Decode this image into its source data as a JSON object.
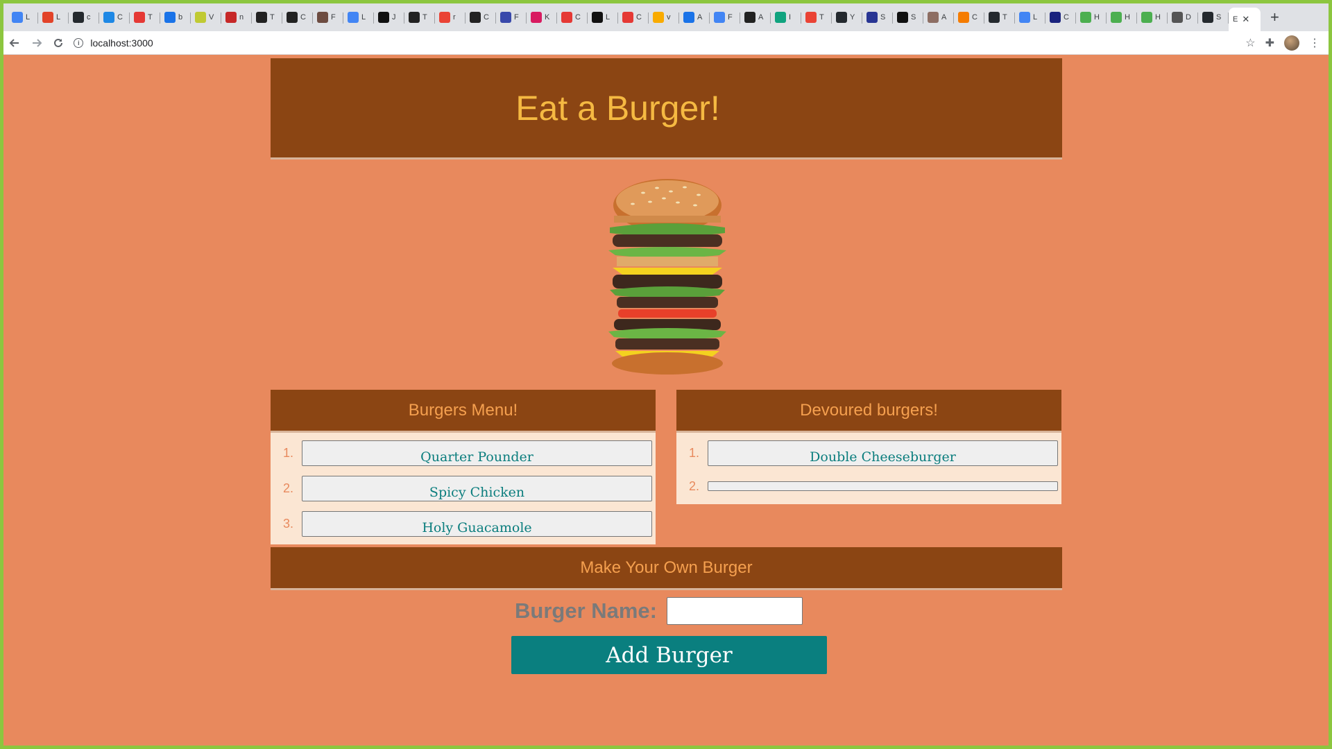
{
  "browser": {
    "tabs": [
      {
        "icon": "google-docs-icon",
        "letter": "L",
        "color": "#4285f4"
      },
      {
        "icon": "gitlab-icon",
        "letter": "L",
        "color": "#e24329"
      },
      {
        "icon": "github-icon",
        "letter": "c",
        "color": "#24292e"
      },
      {
        "icon": "cs-icon",
        "letter": "C",
        "color": "#1e88e5"
      },
      {
        "icon": "u-icon",
        "letter": "T",
        "color": "#e53935"
      },
      {
        "icon": "blue-dot-icon",
        "letter": "b",
        "color": "#1a73e8"
      },
      {
        "icon": "feather-icon",
        "letter": "V",
        "color": "#c0ca33"
      },
      {
        "icon": "red-square-icon",
        "letter": "n",
        "color": "#c62828"
      },
      {
        "icon": "react-icon",
        "letter": "T",
        "color": "#222222"
      },
      {
        "icon": "react-icon",
        "letter": "C",
        "color": "#222222"
      },
      {
        "icon": "chart-icon",
        "letter": "F",
        "color": "#6d4c41"
      },
      {
        "icon": "google-docs-icon",
        "letter": "L",
        "color": "#4285f4"
      },
      {
        "icon": "30-icon",
        "letter": "J",
        "color": "#111111"
      },
      {
        "icon": "react-icon",
        "letter": "T",
        "color": "#222222"
      },
      {
        "icon": "google-icon",
        "letter": "r",
        "color": "#ea4335"
      },
      {
        "icon": "react-icon",
        "letter": "C",
        "color": "#222222"
      },
      {
        "icon": "kcd-icon",
        "letter": "F",
        "color": "#3949ab"
      },
      {
        "icon": "k-icon",
        "letter": "K",
        "color": "#d81b60"
      },
      {
        "icon": "u-icon",
        "letter": "C",
        "color": "#e53935"
      },
      {
        "icon": "dark-square-icon",
        "letter": "L",
        "color": "#111111"
      },
      {
        "icon": "u-icon",
        "letter": "C",
        "color": "#e53935"
      },
      {
        "icon": "slides-icon",
        "letter": "v",
        "color": "#f9ab00"
      },
      {
        "icon": "doc-icon",
        "letter": "A",
        "color": "#1a73e8"
      },
      {
        "icon": "google-docs-icon",
        "letter": "F",
        "color": "#4285f4"
      },
      {
        "icon": "react-icon",
        "letter": "A",
        "color": "#222222"
      },
      {
        "icon": "openai-icon",
        "letter": "I",
        "color": "#10a37f"
      },
      {
        "icon": "gmail-icon",
        "letter": "T",
        "color": "#ea4335"
      },
      {
        "icon": "github-icon",
        "letter": "Y",
        "color": "#24292e"
      },
      {
        "icon": "d-icon",
        "letter": "S",
        "color": "#283593"
      },
      {
        "icon": "medium-icon",
        "letter": "S",
        "color": "#111111"
      },
      {
        "icon": "person-icon",
        "letter": "A",
        "color": "#8d6e63"
      },
      {
        "icon": "badge-icon",
        "letter": "C",
        "color": "#f57c00"
      },
      {
        "icon": "github-icon",
        "letter": "T",
        "color": "#24292e"
      },
      {
        "icon": "google-docs-icon",
        "letter": "L",
        "color": "#4285f4"
      },
      {
        "icon": "stripes-icon",
        "letter": "C",
        "color": "#1a237e"
      },
      {
        "icon": "w3-icon",
        "letter": "H",
        "color": "#4caf50"
      },
      {
        "icon": "w3-icon",
        "letter": "H",
        "color": "#4caf50"
      },
      {
        "icon": "w3-icon",
        "letter": "H",
        "color": "#4caf50"
      },
      {
        "icon": "globe-icon",
        "letter": "D",
        "color": "#555555"
      },
      {
        "icon": "github-icon",
        "letter": "S",
        "color": "#24292e"
      }
    ],
    "active_tab_letter": "E",
    "address": "localhost:3000"
  },
  "page": {
    "title": "Eat a Burger!",
    "menu_panel_title": "Burgers Menu!",
    "menu_items": [
      "Quarter Pounder",
      "Spicy Chicken",
      "Holy Guacamole"
    ],
    "devoured_panel_title": "Devoured burgers!",
    "devoured_items": [
      "Double Cheeseburger",
      ""
    ],
    "form_section_title": "Make Your Own Burger",
    "form_label": "Burger Name:",
    "form_input_value": "",
    "submit_label": "Add Burger"
  },
  "colors": {
    "background": "#e8895d",
    "header": "#8b4513",
    "title": "#f5b942",
    "panel_title": "#f5a04f",
    "button_text": "#0a7d7d",
    "submit": "#0a7f7f"
  }
}
